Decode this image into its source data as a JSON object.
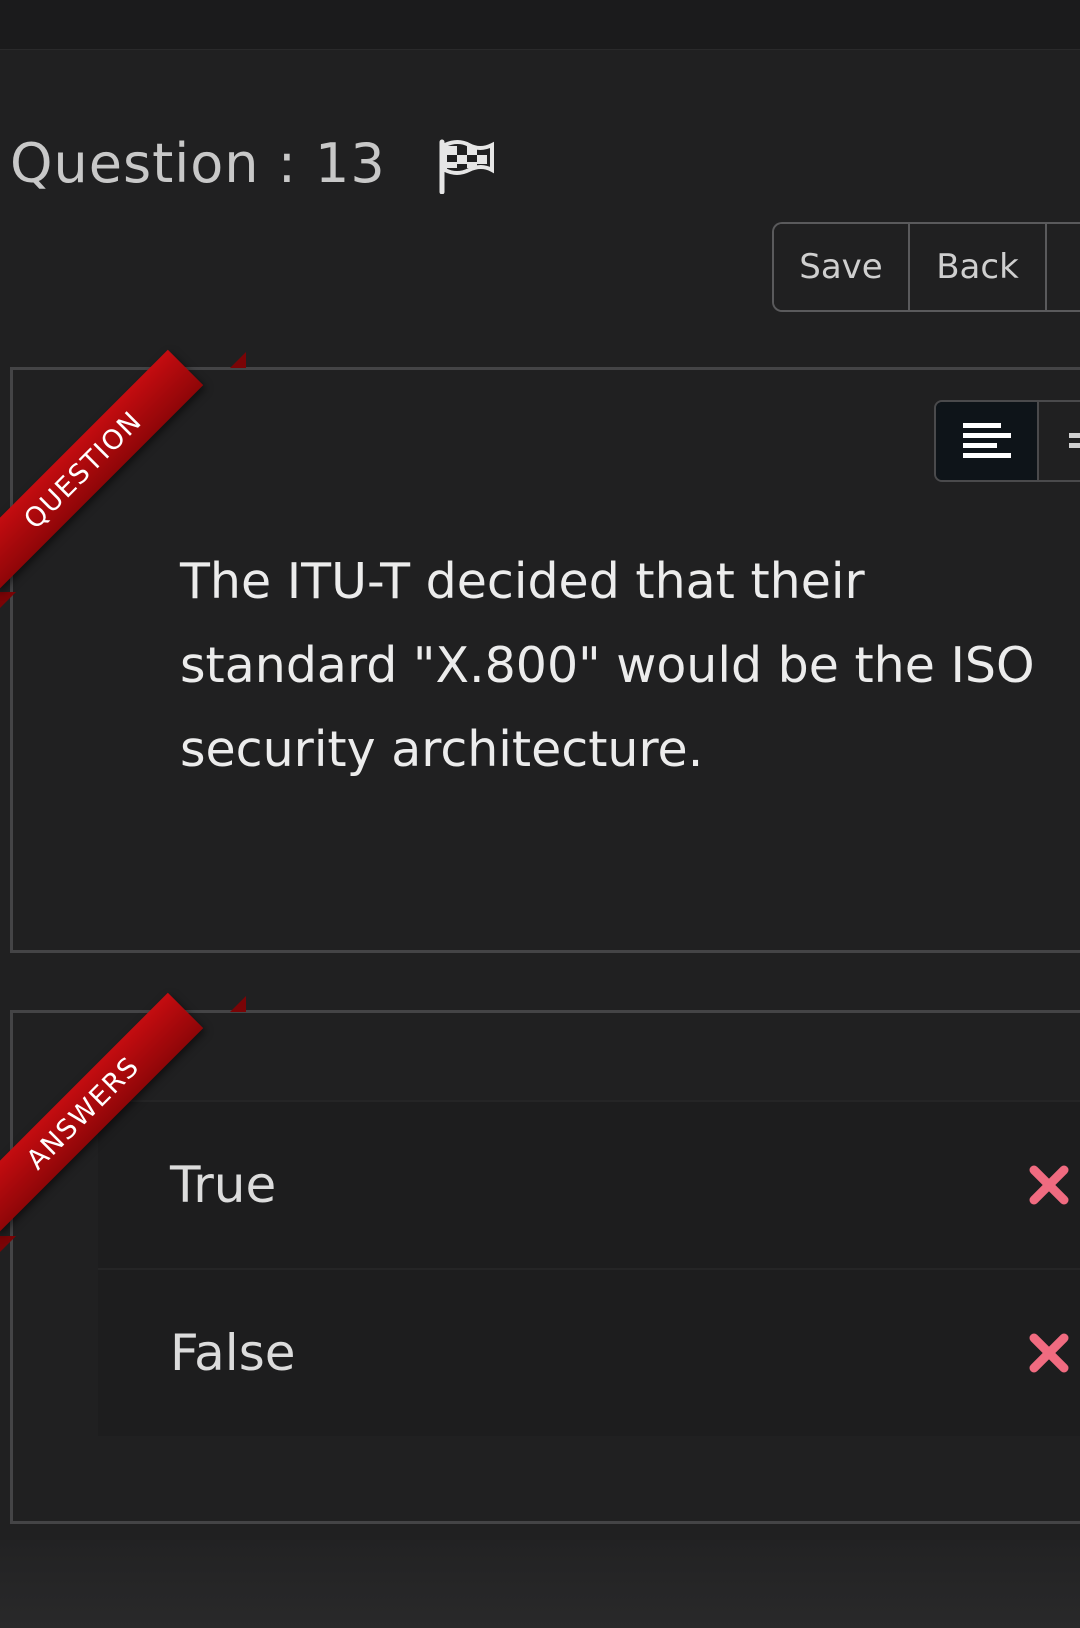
{
  "header": {
    "question_label": "Question : 13",
    "flag_icon": "flag-checkered-icon"
  },
  "toolbar": {
    "save_label": "Save",
    "back_label": "Back"
  },
  "question_panel": {
    "ribbon_label": "QUESTION",
    "align_icon": "align-left-icon",
    "text": "The ITU-T decided that their standard \"X.800\" would be the ISO security architecture."
  },
  "answers_panel": {
    "ribbon_label": "ANSWERS",
    "options": [
      {
        "label": "True",
        "status_icon": "x-mark-icon"
      },
      {
        "label": "False",
        "status_icon": "x-mark-icon"
      }
    ]
  },
  "colors": {
    "ribbon": "#c40c10",
    "x_mark": "#f06b80",
    "background": "#202021"
  }
}
